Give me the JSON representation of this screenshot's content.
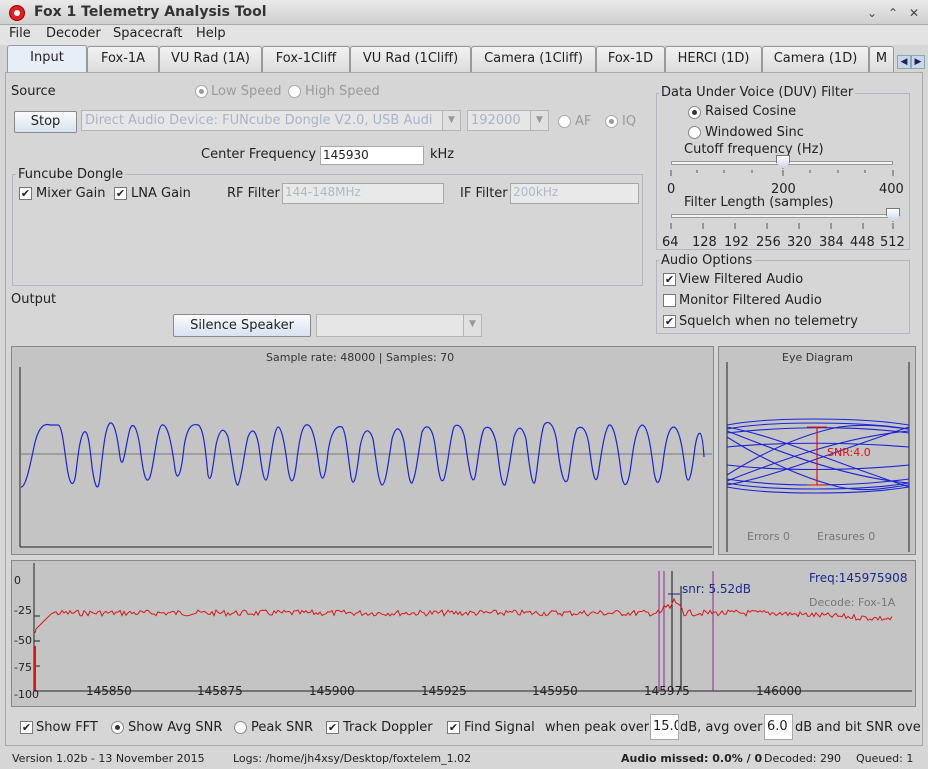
{
  "window": {
    "title": "Fox 1 Telemetry Analysis Tool",
    "minimize": "⌄",
    "maximize": "⌃",
    "close": "✕"
  },
  "menu": [
    "File",
    "Decoder",
    "Spacecraft",
    "Help"
  ],
  "tabs": [
    "Input",
    "Fox-1A",
    "VU Rad (1A)",
    "Fox-1Cliff",
    "VU Rad (1Cliff)",
    "Camera (1Cliff)",
    "Fox-1D",
    "HERCI (1D)",
    "Camera (1D)",
    "M"
  ],
  "tab_nav": {
    "left": "◀",
    "right": "▶"
  },
  "source": {
    "label": "Source",
    "low_speed": "Low Speed",
    "high_speed": "High Speed",
    "stop_button": "Stop",
    "device": "Direct Audio Device: FUNcube Dongle V2.0, USB Audi",
    "rate": "192000",
    "af": "AF",
    "iq": "IQ",
    "center_freq_label": "Center Frequency",
    "center_freq": "145930",
    "center_freq_unit": "kHz"
  },
  "funcube": {
    "label": "Funcube Dongle",
    "mixer_gain": "Mixer Gain",
    "lna_gain": "LNA Gain",
    "rf_filter_label": "RF Filter",
    "rf_filter": "144-148MHz",
    "if_filter_label": "IF Filter",
    "if_filter": "200kHz"
  },
  "output": {
    "label": "Output",
    "silence_button": "Silence Speaker"
  },
  "duv": {
    "label": "Data Under Voice (DUV) Filter",
    "raised_cosine": "Raised Cosine",
    "windowed_sinc": "Windowed Sinc",
    "cutoff_label": "Cutoff frequency (Hz)",
    "cutoff_value": 200,
    "cutoff_ticks": [
      "0",
      "200",
      "400"
    ],
    "length_label": "Filter Length (samples)",
    "length_value": 512,
    "length_ticks": [
      "64",
      "128",
      "192",
      "256",
      "320",
      "384",
      "448",
      "512"
    ]
  },
  "audio": {
    "label": "Audio Options",
    "view_filtered": "View Filtered Audio",
    "monitor_filtered": "Monitor Filtered Audio",
    "squelch": "Squelch when no telemetry"
  },
  "audio_plot": {
    "caption": "Sample rate: 48000 | Samples: 70"
  },
  "eye": {
    "title": "Eye Diagram",
    "snr": "SNR:4.0",
    "errors": "Errors  0",
    "erasures": "Erasures  0"
  },
  "fft": {
    "y_labels": [
      "0",
      "-25",
      "-50",
      "-75",
      "-100"
    ],
    "x_labels": [
      "145850",
      "145875",
      "145900",
      "145925",
      "145950",
      "145975",
      "146000"
    ],
    "snr_text": "snr: 5.52dB",
    "freq_text": "Freq:145975908",
    "decode_text": "Decode: Fox-1A"
  },
  "controls": {
    "show_fft": "Show FFT",
    "show_avg_snr": "Show Avg SNR",
    "peak_snr": "Peak SNR",
    "track_doppler": "Track Doppler",
    "find_signal": "Find Signal",
    "when_peak_over": "when peak over",
    "peak_val": "15.0",
    "db_avg_over": "dB, avg over",
    "avg_val": "6.0",
    "db_and_bit": "dB and bit SNR ove"
  },
  "status": {
    "version": "Version 1.02b - 13 November 2015",
    "logs": "Logs: /home/jh4xsy/Desktop/foxtelem_1.02",
    "audio_missed": "Audio missed: 0.0% / 0",
    "decoded": "Decoded: 290",
    "queued": "Queued: 1"
  },
  "colors": {
    "wave": "#1a24d6",
    "fft": "#d81818",
    "eye_snr": "#e01010",
    "freq": "#1a2a8a",
    "marker": "#8a2a8a"
  }
}
